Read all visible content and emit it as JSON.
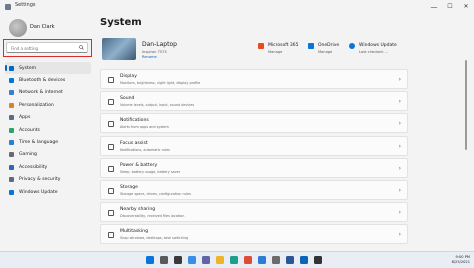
{
  "window": {
    "title": "Settings",
    "minimize": "—",
    "maximize": "☐",
    "close": "✕"
  },
  "sidebar": {
    "user_name": "Dan Clark",
    "search_placeholder": "Find a setting",
    "items": [
      {
        "label": "System",
        "icon": "system-icon",
        "color": "#0067c0",
        "active": true
      },
      {
        "label": "Bluetooth & devices",
        "icon": "bluetooth-icon",
        "color": "#0078d4"
      },
      {
        "label": "Network & internet",
        "icon": "network-icon",
        "color": "#3b7bd0"
      },
      {
        "label": "Personalization",
        "icon": "personalization-icon",
        "color": "#d8822c"
      },
      {
        "label": "Apps",
        "icon": "apps-icon",
        "color": "#5a6f87"
      },
      {
        "label": "Accounts",
        "icon": "accounts-icon",
        "color": "#2fa36b"
      },
      {
        "label": "Time & language",
        "icon": "time-language-icon",
        "color": "#2c7fd0"
      },
      {
        "label": "Gaming",
        "icon": "gaming-icon",
        "color": "#6b6b6b"
      },
      {
        "label": "Accessibility",
        "icon": "accessibility-icon",
        "color": "#2b6cb0"
      },
      {
        "label": "Privacy & security",
        "icon": "shield-icon",
        "color": "#5f6b78"
      },
      {
        "label": "Windows Update",
        "icon": "windows-update-icon",
        "color": "#0a74d8"
      }
    ]
  },
  "main": {
    "title": "System",
    "device": {
      "name": "Dan-Laptop",
      "model": "Inspiron 7573",
      "rename": "Rename"
    },
    "quick_links": [
      {
        "title": "Microsoft 365",
        "sub": "Manage",
        "icon": "microsoft365-icon",
        "color": "#e74c1c"
      },
      {
        "title": "OneDrive",
        "sub": "Manage",
        "icon": "onedrive-icon",
        "color": "#0a74d8"
      },
      {
        "title": "Windows Update",
        "sub": "Last checked: ...",
        "icon": "windows-update-icon",
        "color": "#0a74d8"
      }
    ],
    "cards": [
      {
        "title": "Display",
        "sub": "Monitors, brightness, night light, display profile",
        "icon": "display-icon"
      },
      {
        "title": "Sound",
        "sub": "Volume levels, output, input, sound devices",
        "icon": "sound-icon"
      },
      {
        "title": "Notifications",
        "sub": "Alerts from apps and system",
        "icon": "notifications-icon"
      },
      {
        "title": "Focus assist",
        "sub": "Notifications, automatic rules",
        "icon": "focus-assist-icon"
      },
      {
        "title": "Power & battery",
        "sub": "Sleep, battery usage, battery saver",
        "icon": "power-icon"
      },
      {
        "title": "Storage",
        "sub": "Storage space, drives, configuration rules",
        "icon": "storage-icon"
      },
      {
        "title": "Nearby sharing",
        "sub": "Discoverability, received files location",
        "icon": "nearby-sharing-icon"
      },
      {
        "title": "Multitasking",
        "sub": "Snap windows, desktops, task switching",
        "icon": "multitasking-icon"
      }
    ]
  },
  "taskbar": {
    "apps": [
      {
        "icon": "start-icon",
        "color": "#0a74d8"
      },
      {
        "icon": "search-icon",
        "color": "#5a5a5a"
      },
      {
        "icon": "task-view-icon",
        "color": "#3a3a3a"
      },
      {
        "icon": "widgets-icon",
        "color": "#3a8ee6"
      },
      {
        "icon": "chat-icon",
        "color": "#6264a7"
      },
      {
        "icon": "file-explorer-icon",
        "color": "#f0b429"
      },
      {
        "icon": "edge-icon",
        "color": "#1f9e8f"
      },
      {
        "icon": "chrome-icon",
        "color": "#dd4b39"
      },
      {
        "icon": "store-icon",
        "color": "#2d7bd6"
      },
      {
        "icon": "settings-icon",
        "color": "#6b6b6b"
      },
      {
        "icon": "word-icon",
        "color": "#2b5797"
      },
      {
        "icon": "outlook-icon",
        "color": "#0a64b8"
      },
      {
        "icon": "terminal-icon",
        "color": "#333333"
      }
    ],
    "time": "9:00 PM",
    "date": "8/25/2021"
  }
}
